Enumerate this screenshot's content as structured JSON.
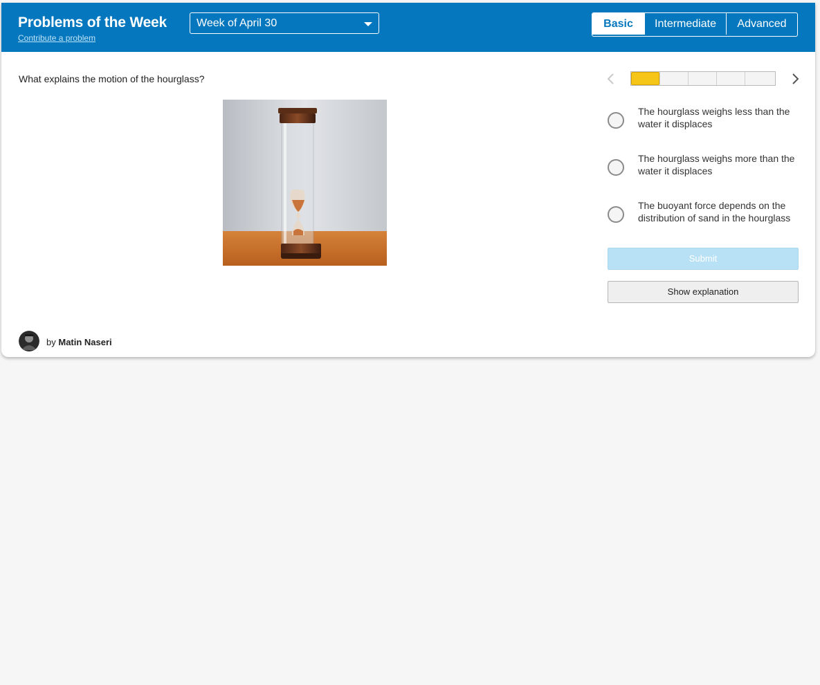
{
  "header": {
    "title": "Problems of the Week",
    "contribute_label": "Contribute a problem",
    "week_selected": "Week of April 30",
    "levels": [
      "Basic",
      "Intermediate",
      "Advanced"
    ],
    "active_level": "Basic"
  },
  "problem": {
    "question": "What explains the motion of the hourglass?",
    "image": "hourglass-in-water-photo",
    "progress": {
      "current": 1,
      "total": 5
    },
    "choices": [
      "The hourglass weighs less than the water it displaces",
      "The hourglass weighs more than the water it displaces",
      "The buoyant force depends on the distribution of sand in the hourglass"
    ],
    "submit_label": "Submit",
    "explanation_label": "Show explanation"
  },
  "author": {
    "prefix": "by",
    "name": "Matin Naseri"
  },
  "colors": {
    "header_bg": "#0577be",
    "progress_current": "#f5c518",
    "submit_disabled_bg": "#b8e1f6"
  }
}
